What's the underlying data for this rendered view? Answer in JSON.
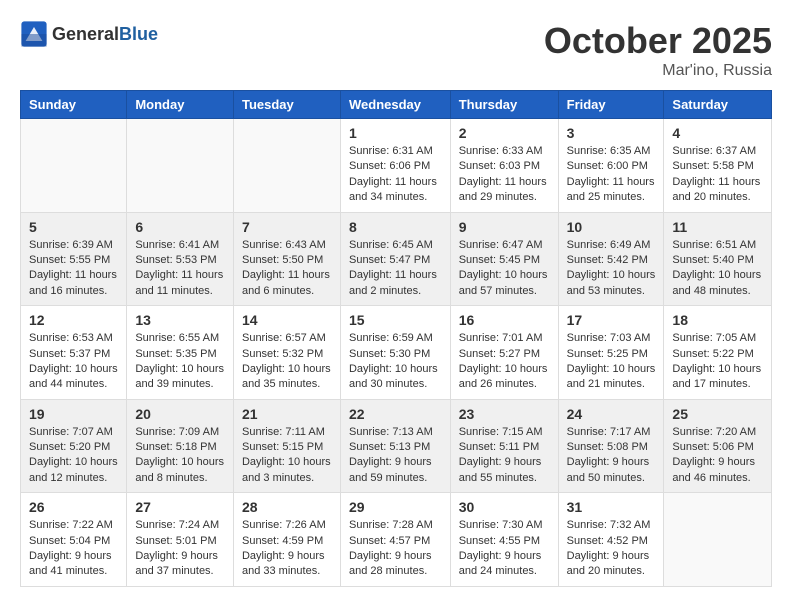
{
  "header": {
    "logo_general": "General",
    "logo_blue": "Blue",
    "month_title": "October 2025",
    "location": "Mar'ino, Russia"
  },
  "weekdays": [
    "Sunday",
    "Monday",
    "Tuesday",
    "Wednesday",
    "Thursday",
    "Friday",
    "Saturday"
  ],
  "weeks": [
    [
      {
        "day": "",
        "info": ""
      },
      {
        "day": "",
        "info": ""
      },
      {
        "day": "",
        "info": ""
      },
      {
        "day": "1",
        "info": "Sunrise: 6:31 AM\nSunset: 6:06 PM\nDaylight: 11 hours\nand 34 minutes."
      },
      {
        "day": "2",
        "info": "Sunrise: 6:33 AM\nSunset: 6:03 PM\nDaylight: 11 hours\nand 29 minutes."
      },
      {
        "day": "3",
        "info": "Sunrise: 6:35 AM\nSunset: 6:00 PM\nDaylight: 11 hours\nand 25 minutes."
      },
      {
        "day": "4",
        "info": "Sunrise: 6:37 AM\nSunset: 5:58 PM\nDaylight: 11 hours\nand 20 minutes."
      }
    ],
    [
      {
        "day": "5",
        "info": "Sunrise: 6:39 AM\nSunset: 5:55 PM\nDaylight: 11 hours\nand 16 minutes."
      },
      {
        "day": "6",
        "info": "Sunrise: 6:41 AM\nSunset: 5:53 PM\nDaylight: 11 hours\nand 11 minutes."
      },
      {
        "day": "7",
        "info": "Sunrise: 6:43 AM\nSunset: 5:50 PM\nDaylight: 11 hours\nand 6 minutes."
      },
      {
        "day": "8",
        "info": "Sunrise: 6:45 AM\nSunset: 5:47 PM\nDaylight: 11 hours\nand 2 minutes."
      },
      {
        "day": "9",
        "info": "Sunrise: 6:47 AM\nSunset: 5:45 PM\nDaylight: 10 hours\nand 57 minutes."
      },
      {
        "day": "10",
        "info": "Sunrise: 6:49 AM\nSunset: 5:42 PM\nDaylight: 10 hours\nand 53 minutes."
      },
      {
        "day": "11",
        "info": "Sunrise: 6:51 AM\nSunset: 5:40 PM\nDaylight: 10 hours\nand 48 minutes."
      }
    ],
    [
      {
        "day": "12",
        "info": "Sunrise: 6:53 AM\nSunset: 5:37 PM\nDaylight: 10 hours\nand 44 minutes."
      },
      {
        "day": "13",
        "info": "Sunrise: 6:55 AM\nSunset: 5:35 PM\nDaylight: 10 hours\nand 39 minutes."
      },
      {
        "day": "14",
        "info": "Sunrise: 6:57 AM\nSunset: 5:32 PM\nDaylight: 10 hours\nand 35 minutes."
      },
      {
        "day": "15",
        "info": "Sunrise: 6:59 AM\nSunset: 5:30 PM\nDaylight: 10 hours\nand 30 minutes."
      },
      {
        "day": "16",
        "info": "Sunrise: 7:01 AM\nSunset: 5:27 PM\nDaylight: 10 hours\nand 26 minutes."
      },
      {
        "day": "17",
        "info": "Sunrise: 7:03 AM\nSunset: 5:25 PM\nDaylight: 10 hours\nand 21 minutes."
      },
      {
        "day": "18",
        "info": "Sunrise: 7:05 AM\nSunset: 5:22 PM\nDaylight: 10 hours\nand 17 minutes."
      }
    ],
    [
      {
        "day": "19",
        "info": "Sunrise: 7:07 AM\nSunset: 5:20 PM\nDaylight: 10 hours\nand 12 minutes."
      },
      {
        "day": "20",
        "info": "Sunrise: 7:09 AM\nSunset: 5:18 PM\nDaylight: 10 hours\nand 8 minutes."
      },
      {
        "day": "21",
        "info": "Sunrise: 7:11 AM\nSunset: 5:15 PM\nDaylight: 10 hours\nand 3 minutes."
      },
      {
        "day": "22",
        "info": "Sunrise: 7:13 AM\nSunset: 5:13 PM\nDaylight: 9 hours\nand 59 minutes."
      },
      {
        "day": "23",
        "info": "Sunrise: 7:15 AM\nSunset: 5:11 PM\nDaylight: 9 hours\nand 55 minutes."
      },
      {
        "day": "24",
        "info": "Sunrise: 7:17 AM\nSunset: 5:08 PM\nDaylight: 9 hours\nand 50 minutes."
      },
      {
        "day": "25",
        "info": "Sunrise: 7:20 AM\nSunset: 5:06 PM\nDaylight: 9 hours\nand 46 minutes."
      }
    ],
    [
      {
        "day": "26",
        "info": "Sunrise: 7:22 AM\nSunset: 5:04 PM\nDaylight: 9 hours\nand 41 minutes."
      },
      {
        "day": "27",
        "info": "Sunrise: 7:24 AM\nSunset: 5:01 PM\nDaylight: 9 hours\nand 37 minutes."
      },
      {
        "day": "28",
        "info": "Sunrise: 7:26 AM\nSunset: 4:59 PM\nDaylight: 9 hours\nand 33 minutes."
      },
      {
        "day": "29",
        "info": "Sunrise: 7:28 AM\nSunset: 4:57 PM\nDaylight: 9 hours\nand 28 minutes."
      },
      {
        "day": "30",
        "info": "Sunrise: 7:30 AM\nSunset: 4:55 PM\nDaylight: 9 hours\nand 24 minutes."
      },
      {
        "day": "31",
        "info": "Sunrise: 7:32 AM\nSunset: 4:52 PM\nDaylight: 9 hours\nand 20 minutes."
      },
      {
        "day": "",
        "info": ""
      }
    ]
  ]
}
